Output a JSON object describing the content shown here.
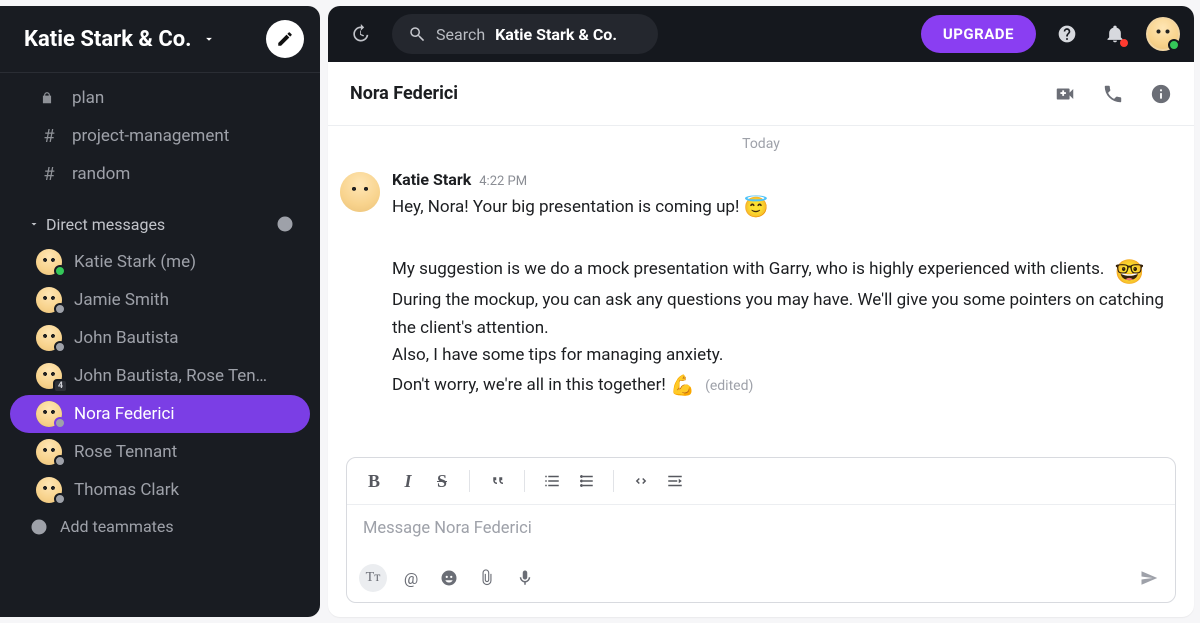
{
  "workspace": {
    "name": "Katie Stark & Co."
  },
  "sidebar": {
    "channels": [
      {
        "name": "plan",
        "private": true
      },
      {
        "name": "project-management",
        "private": false
      },
      {
        "name": "random",
        "private": false
      }
    ],
    "dm_section_label": "Direct messages",
    "dms": [
      {
        "name": "Katie Stark (me)",
        "online": true
      },
      {
        "name": "Jamie Smith",
        "online": false
      },
      {
        "name": "John Bautista",
        "online": false
      },
      {
        "name": "John Bautista, Rose Ten…",
        "badge": "4"
      },
      {
        "name": "Nora Federici",
        "online": false,
        "active": true
      },
      {
        "name": "Rose Tennant",
        "online": false
      },
      {
        "name": "Thomas Clark",
        "online": false
      }
    ],
    "add_teammates": "Add teammates"
  },
  "topbar": {
    "search_label": "Search",
    "search_workspace": "Katie Stark & Co.",
    "upgrade": "UPGRADE"
  },
  "conversation": {
    "title": "Nora Federici",
    "date_separator": "Today",
    "message": {
      "author": "Katie Stark",
      "time": "4:22 PM",
      "line1": "Hey, Nora! Your big presentation is coming up! ",
      "emoji1": "😇",
      "para2a": "My suggestion is we do a mock presentation with Garry, who is highly experienced with clients. ",
      "emoji2": "🤓",
      "para2b": "During the mockup, you can ask any questions you may have. We'll give you some pointers on catching the client's attention.",
      "para3": "Also, I have some tips for managing anxiety.",
      "para4": "Don't worry, we're all in this together! ",
      "emoji3": "💪",
      "edited": "(edited)"
    }
  },
  "composer": {
    "placeholder": "Message Nora Federici"
  }
}
